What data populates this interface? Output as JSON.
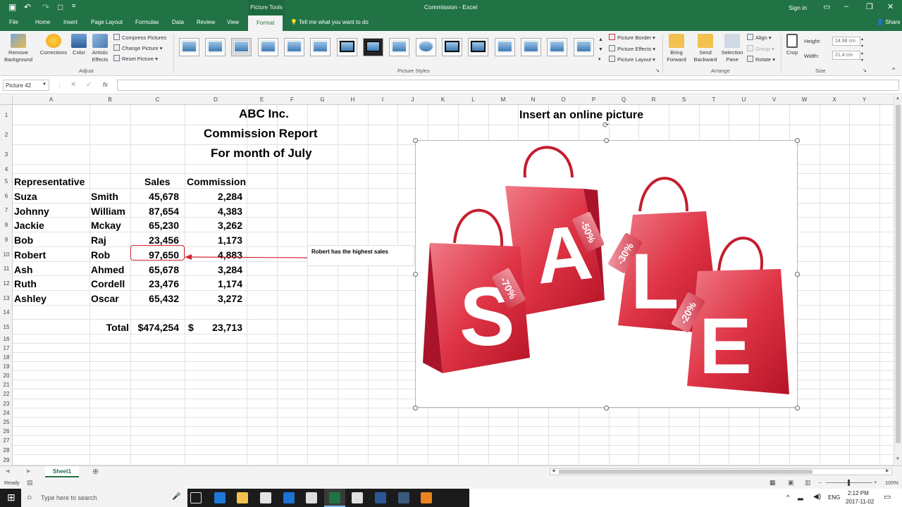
{
  "titlebar": {
    "title": "Commission - Excel",
    "context_tab": "Picture Tools",
    "signin": "Sign in"
  },
  "tabs": [
    "File",
    "Home",
    "Insert",
    "Page Layout",
    "Formulas",
    "Data",
    "Review",
    "View",
    "Format"
  ],
  "active_tab": "Format",
  "tell_me": "Tell me what you want to do",
  "share": "Share",
  "ribbon": {
    "adjust": {
      "remove_bg": "Remove Background",
      "corrections": "Corrections",
      "color": "Color",
      "artistic": "Artistic Effects",
      "compress": "Compress Pictures",
      "change": "Change Picture",
      "reset": "Reset Picture",
      "label": "Adjust"
    },
    "styles_label": "Picture Styles",
    "picture_border": "Picture Border",
    "picture_effects": "Picture Effects",
    "picture_layout": "Picture Layout",
    "arrange": {
      "bring": "Bring Forward",
      "send": "Send Backward",
      "selection": "Selection Pane",
      "align": "Align",
      "group": "Group",
      "rotate": "Rotate",
      "label": "Arrange"
    },
    "size": {
      "crop": "Crop",
      "height_label": "Height:",
      "height": "14.98 cm",
      "width_label": "Width:",
      "width": "21.4 cm",
      "label": "Size"
    }
  },
  "namebox": "Picture 42",
  "columns": [
    "A",
    "B",
    "C",
    "D",
    "E",
    "F",
    "G",
    "H",
    "I",
    "J",
    "K",
    "L",
    "M",
    "N",
    "O",
    "P",
    "Q",
    "R",
    "S",
    "T",
    "U",
    "V",
    "W",
    "X",
    "Y"
  ],
  "rows": [
    "1",
    "2",
    "3",
    "4",
    "5",
    "6",
    "7",
    "8",
    "9",
    "10",
    "11",
    "12",
    "13",
    "14",
    "15",
    "16",
    "17",
    "18",
    "19",
    "20",
    "21",
    "22",
    "23",
    "24",
    "25",
    "26",
    "27",
    "28",
    "29"
  ],
  "report": {
    "company": "ABC Inc.",
    "title": "Commission Report",
    "period": "For month of July",
    "picture_note": "Insert an online  picture"
  },
  "table_headers": {
    "rep": "Representative",
    "sales": "Sales",
    "commission": "Commission"
  },
  "table_rows": [
    {
      "first": "Suza",
      "last": "Smith",
      "sales": "45,678",
      "commission": "2,284"
    },
    {
      "first": "Johnny",
      "last": "William",
      "sales": "87,654",
      "commission": "4,383"
    },
    {
      "first": "Jackie",
      "last": "Mckay",
      "sales": "65,230",
      "commission": "3,262"
    },
    {
      "first": "Bob",
      "last": "Raj",
      "sales": "23,456",
      "commission": "1,173"
    },
    {
      "first": "Robert",
      "last": "Rob",
      "sales": "97,650",
      "commission": "4,883"
    },
    {
      "first": "Ash",
      "last": "Ahmed",
      "sales": "65,678",
      "commission": "3,284"
    },
    {
      "first": "Ruth",
      "last": "Cordell",
      "sales": "23,476",
      "commission": "1,174"
    },
    {
      "first": "Ashley",
      "last": "Oscar",
      "sales": "65,432",
      "commission": "3,272"
    }
  ],
  "totals": {
    "label": "Total",
    "sales": "$474,254",
    "currency": "$",
    "commission": "23,713"
  },
  "callout": "Robert has the highest sales",
  "picture": {
    "letters": [
      "S",
      "A",
      "L",
      "E"
    ],
    "tags": [
      "-70%",
      "-50%",
      "-30%",
      "-20%"
    ],
    "bag_color": "#d9202f"
  },
  "sheet_tab": "Sheet1",
  "status": {
    "ready": "Ready",
    "zoom": "100%"
  },
  "taskbar": {
    "search_placeholder": "Type here to search",
    "lang": "ENG",
    "time": "2:12 PM",
    "date": "2017-11-02"
  }
}
